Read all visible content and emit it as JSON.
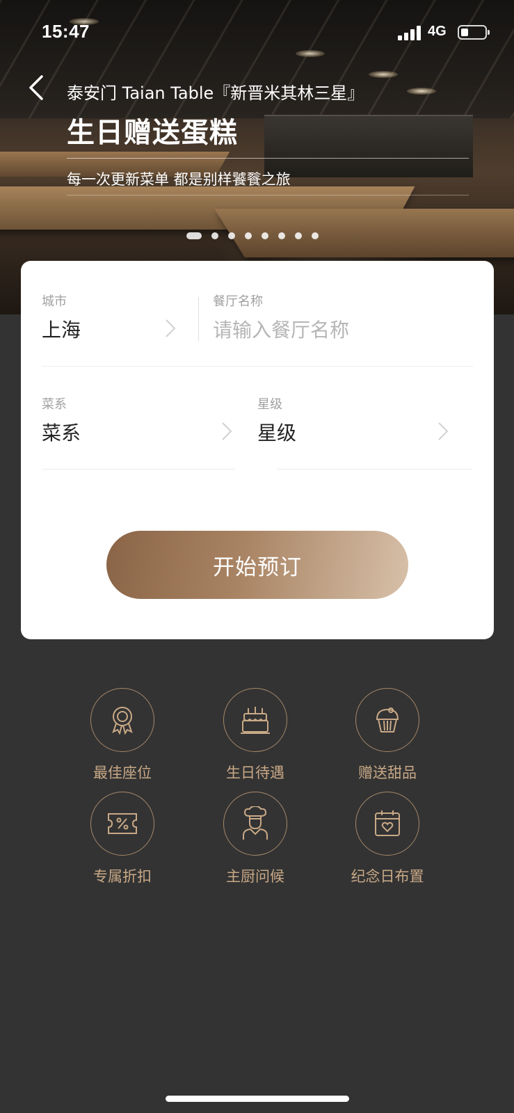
{
  "status_bar": {
    "time": "15:47",
    "network": "4G"
  },
  "header": {
    "back_icon": "chevron-left-icon",
    "restaurant_name": "泰安门 Taian Table『新晋米其林三星』",
    "promo_title": "生日赠送蛋糕",
    "promo_subtitle": "每一次更新菜单 都是别样饕餮之旅",
    "carousel": {
      "total": 8,
      "active_index": 0
    }
  },
  "booking_form": {
    "city": {
      "label": "城市",
      "value": "上海"
    },
    "restaurant": {
      "label": "餐厅名称",
      "placeholder": "请输入餐厅名称",
      "value": ""
    },
    "cuisine": {
      "label": "菜系",
      "value": "菜系"
    },
    "rating": {
      "label": "星级",
      "value": "星级"
    },
    "submit_label": "开始预订"
  },
  "benefits": [
    {
      "icon": "award-medal-icon",
      "label": "最佳座位"
    },
    {
      "icon": "birthday-cake-icon",
      "label": "生日待遇"
    },
    {
      "icon": "cupcake-icon",
      "label": "赠送甜品"
    },
    {
      "icon": "discount-ticket-icon",
      "label": "专属折扣"
    },
    {
      "icon": "chef-icon",
      "label": "主厨问候"
    },
    {
      "icon": "calendar-heart-icon",
      "label": "纪念日布置"
    }
  ],
  "colors": {
    "background": "#333333",
    "accent_gold": "#c9a987",
    "button_start": "#8a6446",
    "button_end": "#d7c0a9"
  }
}
